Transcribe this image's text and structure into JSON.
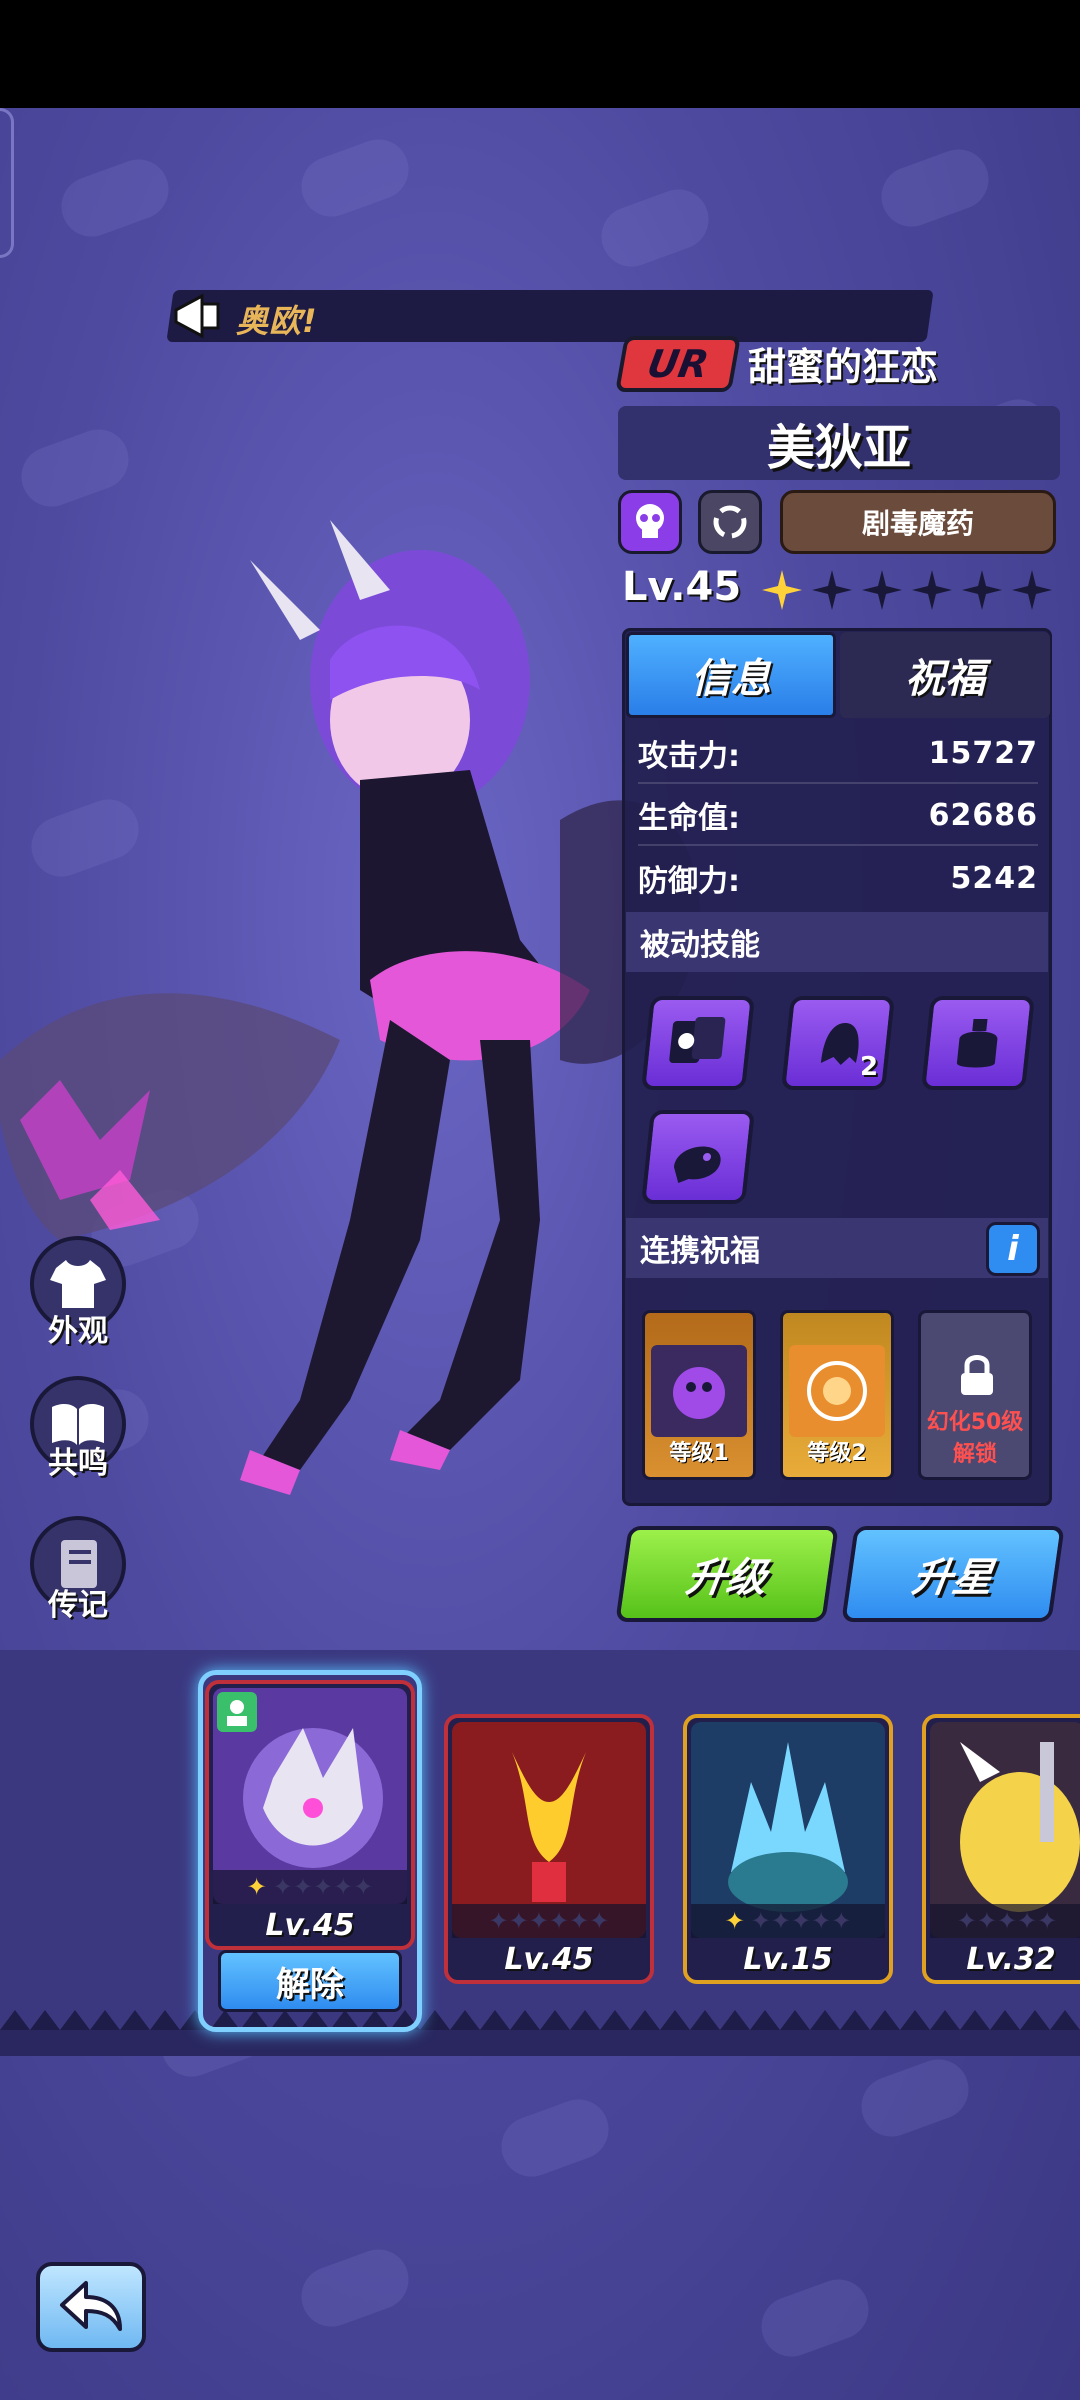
{
  "shout": {
    "text": "奥欧!"
  },
  "hero": {
    "rarity": "UR",
    "title": "甜蜜的狂恋",
    "name": "美狄亚",
    "type": "剧毒魔药",
    "level": "Lv.45",
    "stars_filled": 1,
    "stars_total": 6
  },
  "tabs": {
    "info": "信息",
    "blessing": "祝福",
    "active": "info"
  },
  "stats": [
    {
      "label": "攻击力:",
      "value": "15727"
    },
    {
      "label": "生命值:",
      "value": "62686"
    },
    {
      "label": "防御力:",
      "value": "5242"
    }
  ],
  "passive": {
    "heading": "被动技能",
    "skill_count_badge": "2"
  },
  "link_blessing": {
    "heading": "连携祝福",
    "info_button": "i",
    "cards": [
      {
        "label": "等级1"
      },
      {
        "label": "等级2"
      },
      {
        "lock_line1": "幻化50级",
        "lock_line2": "解锁"
      }
    ]
  },
  "actions": {
    "upgrade": "升级",
    "star_up": "升星"
  },
  "side_menu": [
    {
      "label": "外观",
      "icon": "shirt-icon"
    },
    {
      "label": "共鸣",
      "icon": "book-icon"
    },
    {
      "label": "传记",
      "icon": "journal-icon"
    }
  ],
  "roster": [
    {
      "level": "Lv.45",
      "stars_filled": 1,
      "selected": true,
      "action": "解除"
    },
    {
      "level": "Lv.45",
      "stars_filled": 0
    },
    {
      "level": "Lv.15",
      "stars_filled": 1
    },
    {
      "level": "Lv.32",
      "stars_filled": 0
    }
  ],
  "colors": {
    "background": "#4e4aa0",
    "rarity": "#e0363d",
    "upgrade": "#56c21a",
    "star_up": "#2f8cf0",
    "skill": "#8b3ee8",
    "shout_text": "#e8b658"
  }
}
